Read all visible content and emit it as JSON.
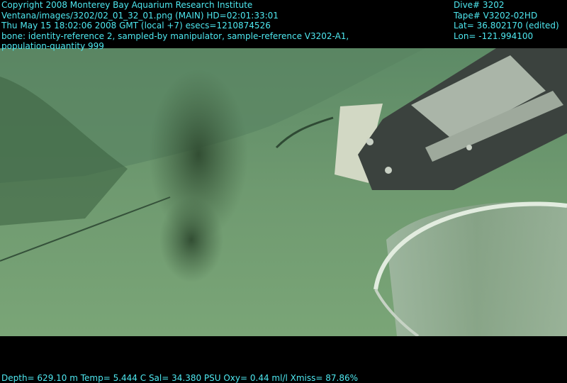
{
  "overlay": {
    "left_lines": [
      "Copyright 2008 Monterey Bay Aquarium Research Institute",
      "Ventana/images/3202/02_01_32_01.png (MAIN)  HD=02:01:33:01",
      "Thu May 15 18:02:06 2008 GMT (local +7)  esecs=1210874526",
      "bone: identity-reference 2, sampled-by manipulator, sample-reference V3202-A1,",
      "population-quantity 999"
    ],
    "right_lines": [
      "Dive# 3202",
      "Tape# V3202-02HD",
      "Lat= 36.802170 (edited)",
      "Lon= -121.994100"
    ],
    "bottom_line": "Depth= 629.10 m  Temp= 5.444 C  Sal= 34.380 PSU  Oxy= 0.44 ml/l  Xmiss= 87.86%"
  },
  "colors": {
    "overlay_text": "#4ee8f0",
    "background": "#000000",
    "seafloor": "#6f9a72"
  }
}
